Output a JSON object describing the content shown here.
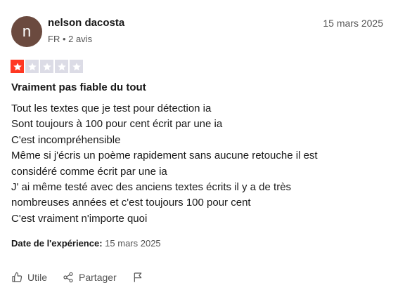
{
  "reviewer": {
    "avatar_letter": "n",
    "name": "nelson dacosta",
    "meta": "FR • 2 avis",
    "review_date": "15 mars 2025"
  },
  "rating": {
    "value": 1,
    "max": 5,
    "active_color": "#ff3722",
    "inactive_color": "#dcdce6"
  },
  "review": {
    "title": "Vraiment pas fiable du tout",
    "lines": [
      "Tout les textes que je test pour détection ia",
      "Sont toujours à 100 pour cent écrit par une ia",
      "C'est incompréhensible",
      "Même si j'écris un poème rapidement sans aucune retouche il est",
      "considéré comme écrit par une ia",
      "J' ai même testé avec des anciens textes écrits il y a de très",
      "nombreuses années et c'est toujours 100 pour cent",
      "C'est vraiment n'importe quoi"
    ],
    "experience_label": "Date de l'expérience:",
    "experience_date": "15 mars 2025"
  },
  "actions": {
    "useful_label": "Utile",
    "share_label": "Partager",
    "useful_icon": "thumbs-up-icon",
    "share_icon": "share-icon",
    "flag_icon": "flag-icon"
  }
}
